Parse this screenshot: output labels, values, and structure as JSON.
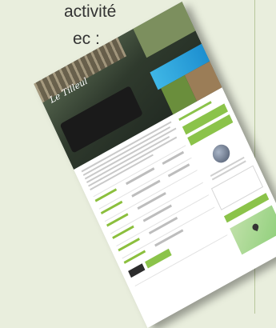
{
  "intro": {
    "line1": "activité",
    "line2": "ec :"
  },
  "colors": {
    "background": "#e9eedd",
    "accent": "#8bc34a",
    "rule": "#b8c79c"
  },
  "preview": {
    "logo_text": "Le Tilleul"
  }
}
